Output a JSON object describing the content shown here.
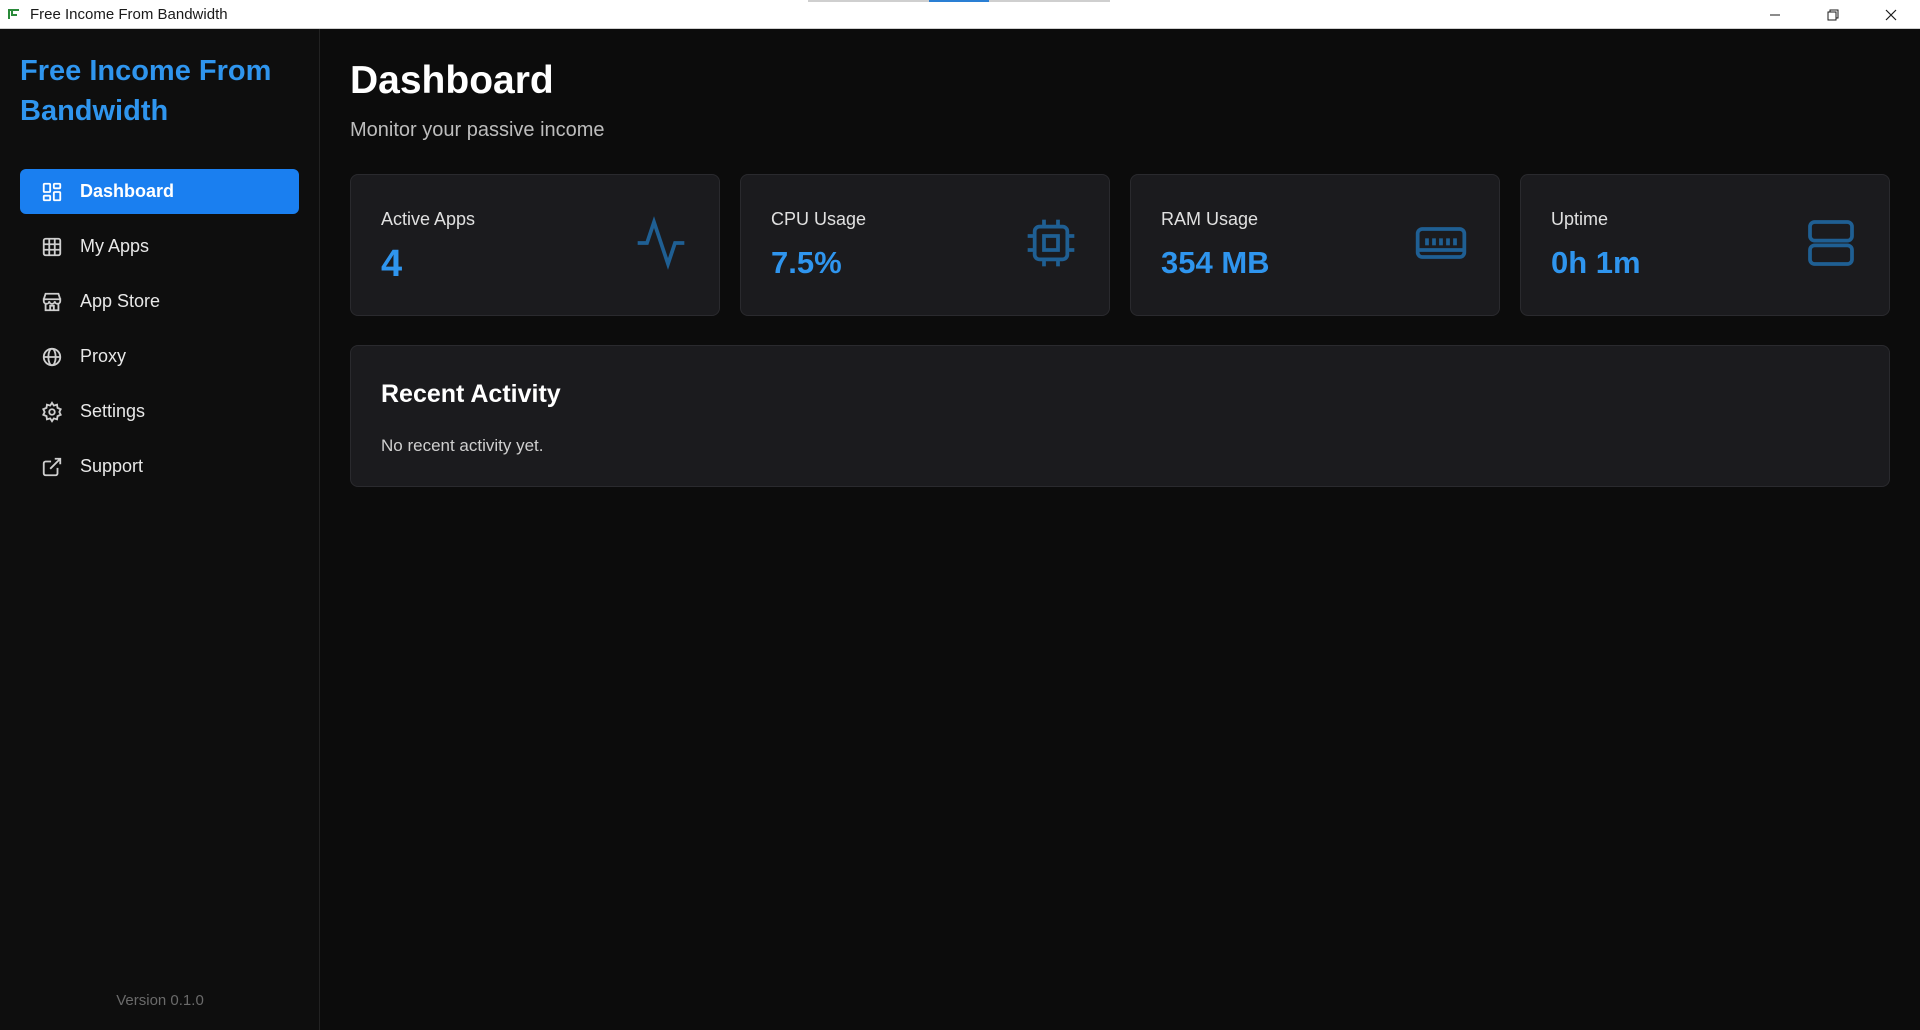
{
  "window": {
    "title": "Free Income From Bandwidth"
  },
  "sidebar": {
    "brand": "Free Income From Bandwidth",
    "items": [
      {
        "label": "Dashboard",
        "icon": "layout-grid-icon",
        "active": true
      },
      {
        "label": "My Apps",
        "icon": "grid-icon",
        "active": false
      },
      {
        "label": "App Store",
        "icon": "store-icon",
        "active": false
      },
      {
        "label": "Proxy",
        "icon": "globe-icon",
        "active": false
      },
      {
        "label": "Settings",
        "icon": "gear-icon",
        "active": false
      },
      {
        "label": "Support",
        "icon": "external-link-icon",
        "active": false
      }
    ],
    "version": "Version 0.1.0"
  },
  "main": {
    "title": "Dashboard",
    "subtitle": "Monitor your passive income",
    "cards": [
      {
        "label": "Active Apps",
        "value": "4",
        "icon": "activity-icon"
      },
      {
        "label": "CPU Usage",
        "value": "7.5%",
        "icon": "cpu-icon"
      },
      {
        "label": "RAM Usage",
        "value": "354 MB",
        "icon": "memory-icon"
      },
      {
        "label": "Uptime",
        "value": "0h 1m",
        "icon": "server-icon"
      }
    ],
    "activity": {
      "title": "Recent Activity",
      "empty_text": "No recent activity yet."
    }
  },
  "colors": {
    "accent": "#2f95ee",
    "active_nav": "#1a7ff0",
    "card_bg": "#1b1b1e",
    "bg": "#0c0c0c"
  }
}
